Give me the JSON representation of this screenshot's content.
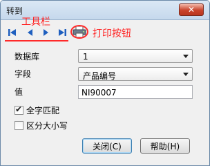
{
  "window": {
    "title": "转到",
    "close_glyph": "✕"
  },
  "toolbar": {
    "buttons": [
      "first-icon",
      "previous-icon",
      "next-icon",
      "last-icon",
      "printer-icon"
    ],
    "annotation_toolbar": "工具栏",
    "annotation_print": "打印按钮",
    "annotation_color": "#ff2020"
  },
  "form": {
    "database_label": "数据库",
    "database_value": "1",
    "field_label": "字段",
    "field_value": "产品编号",
    "value_label": "值",
    "value_input": "NI90007"
  },
  "options": {
    "whole_match_label": "全字匹配",
    "whole_match_checked": true,
    "case_sensitive_label": "区分大小写",
    "case_sensitive_checked": false
  },
  "buttons": {
    "close_label": "关闭(C)",
    "help_label": "帮助(H)"
  },
  "colors": {
    "nav_icon": "#1f5fbf",
    "accent_red": "#ff2a2a"
  }
}
